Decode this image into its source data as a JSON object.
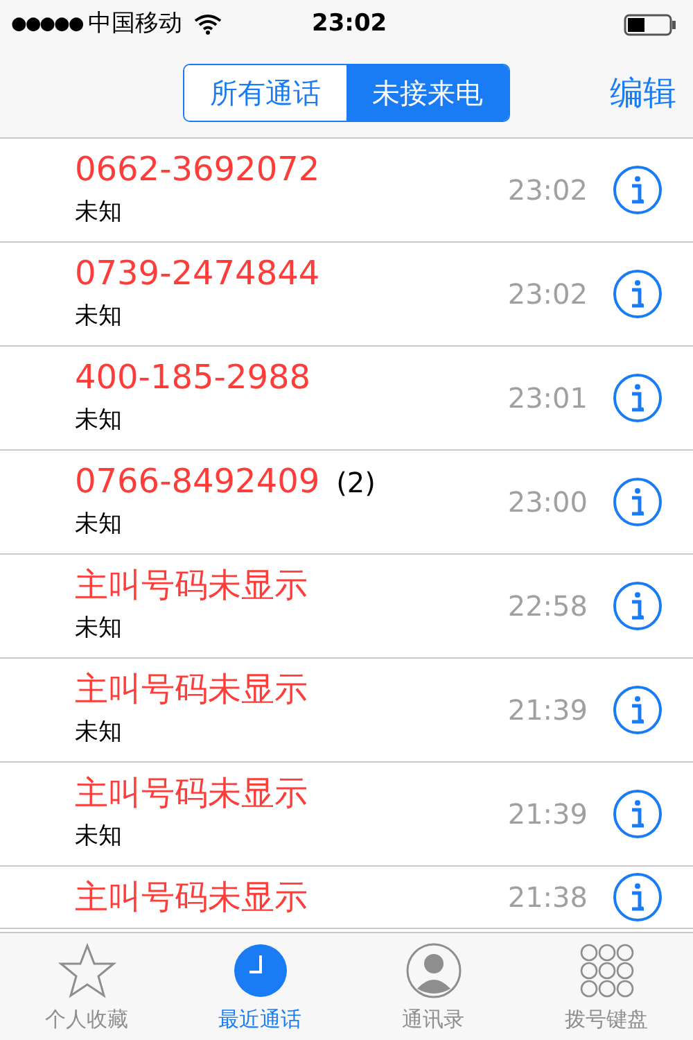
{
  "status_bar": {
    "signal_dots": "●●●●●",
    "carrier": "中国移动",
    "time": "23:02"
  },
  "nav": {
    "segments": [
      {
        "label": "所有通话",
        "selected": false
      },
      {
        "label": "未接来电",
        "selected": true
      }
    ],
    "edit": "编辑"
  },
  "calls": [
    {
      "name": "0662-3692072",
      "label": "未知",
      "time": "23:02"
    },
    {
      "name": "0739-2474844",
      "label": "未知",
      "time": "23:02"
    },
    {
      "name": "400-185-2988",
      "label": "未知",
      "time": "23:01"
    },
    {
      "name": "0766-8492409",
      "count": "(2)",
      "label": "未知",
      "time": "23:00"
    },
    {
      "name": "主叫号码未显示",
      "label": "未知",
      "time": "22:58"
    },
    {
      "name": "主叫号码未显示",
      "label": "未知",
      "time": "21:39"
    },
    {
      "name": "主叫号码未显示",
      "label": "未知",
      "time": "21:39"
    },
    {
      "name": "主叫号码未显示",
      "time": "21:38"
    }
  ],
  "tab_bar": [
    {
      "label": "个人收藏",
      "kind": "star",
      "selected": false
    },
    {
      "label": "最近通话",
      "kind": "clock",
      "selected": true
    },
    {
      "label": "通讯录",
      "kind": "person",
      "selected": false
    },
    {
      "label": "拨号键盘",
      "kind": "keypad",
      "selected": false
    }
  ]
}
